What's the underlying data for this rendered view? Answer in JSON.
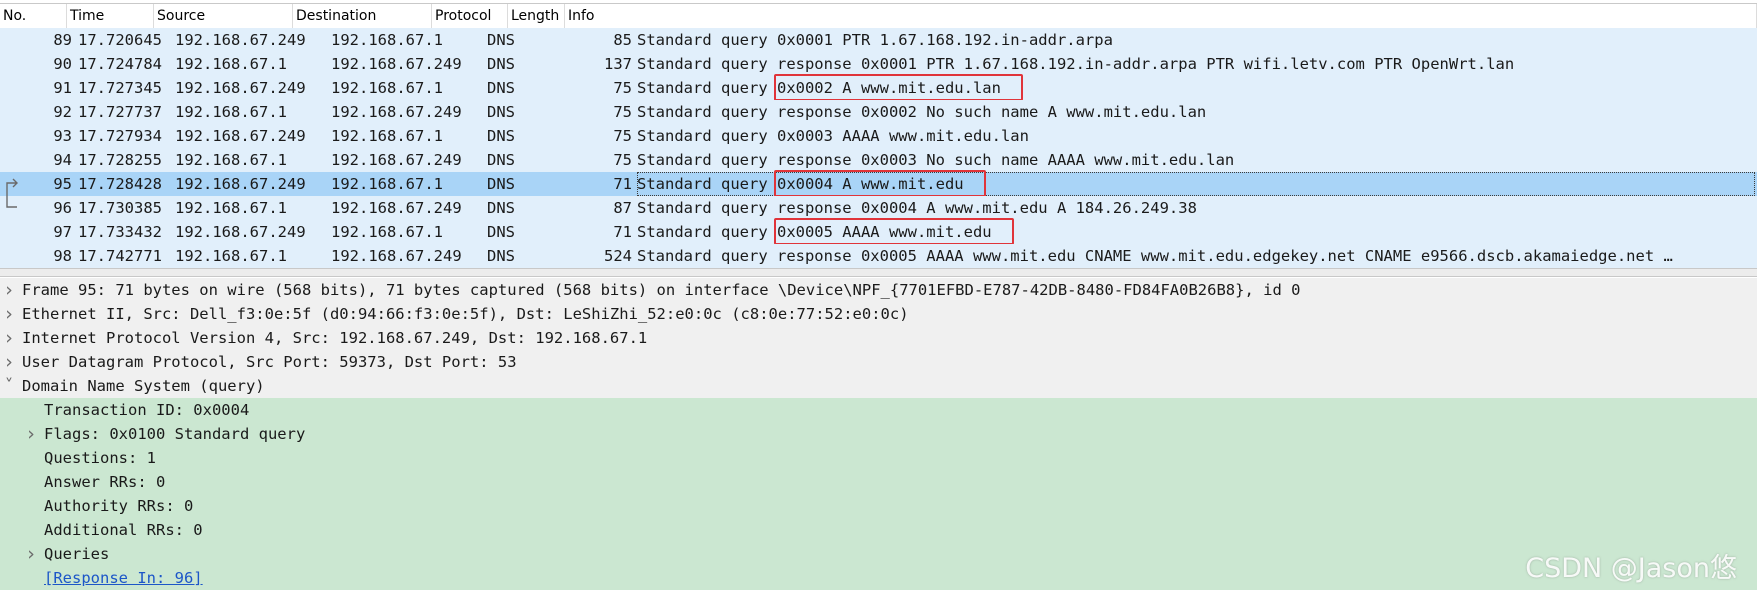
{
  "columns": [
    "No.",
    "Time",
    "Source",
    "Destination",
    "Protocol",
    "Length",
    "Info"
  ],
  "packets": [
    {
      "no": "89",
      "time": "17.720645",
      "src": "192.168.67.249",
      "dst": "192.168.67.1",
      "proto": "DNS",
      "len": "85",
      "info_prefix": "Standard query ",
      "info_rest": "0x0001 PTR 1.67.168.192.in-addr.arpa",
      "highlighted": false,
      "selected": false,
      "marker": ""
    },
    {
      "no": "90",
      "time": "17.724784",
      "src": "192.168.67.1",
      "dst": "192.168.67.249",
      "proto": "DNS",
      "len": "137",
      "info_prefix": "Standard query ",
      "info_rest": "response 0x0001 PTR 1.67.168.192.in-addr.arpa PTR wifi.letv.com PTR OpenWrt.lan",
      "highlighted": false,
      "selected": false,
      "marker": ""
    },
    {
      "no": "91",
      "time": "17.727345",
      "src": "192.168.67.249",
      "dst": "192.168.67.1",
      "proto": "DNS",
      "len": "75",
      "info_prefix": "Standard query ",
      "info_rest": "0x0002 A www.mit.edu.lan",
      "highlighted": true,
      "selected": false,
      "marker": ""
    },
    {
      "no": "92",
      "time": "17.727737",
      "src": "192.168.67.1",
      "dst": "192.168.67.249",
      "proto": "DNS",
      "len": "75",
      "info_prefix": "Standard query ",
      "info_rest": "response 0x0002 No such name A www.mit.edu.lan",
      "highlighted": false,
      "selected": false,
      "marker": ""
    },
    {
      "no": "93",
      "time": "17.727934",
      "src": "192.168.67.249",
      "dst": "192.168.67.1",
      "proto": "DNS",
      "len": "75",
      "info_prefix": "Standard query ",
      "info_rest": "0x0003 AAAA www.mit.edu.lan",
      "highlighted": false,
      "selected": false,
      "marker": ""
    },
    {
      "no": "94",
      "time": "17.728255",
      "src": "192.168.67.1",
      "dst": "192.168.67.249",
      "proto": "DNS",
      "len": "75",
      "info_prefix": "Standard query ",
      "info_rest": "response 0x0003 No such name AAAA www.mit.edu.lan",
      "highlighted": false,
      "selected": false,
      "marker": ""
    },
    {
      "no": "95",
      "time": "17.728428",
      "src": "192.168.67.249",
      "dst": "192.168.67.1",
      "proto": "DNS",
      "len": "71",
      "info_prefix": "Standard query ",
      "info_rest": "0x0004 A www.mit.edu",
      "highlighted": true,
      "selected": true,
      "marker": "request"
    },
    {
      "no": "96",
      "time": "17.730385",
      "src": "192.168.67.1",
      "dst": "192.168.67.249",
      "proto": "DNS",
      "len": "87",
      "info_prefix": "Standard query ",
      "info_rest": "response 0x0004 A www.mit.edu A 184.26.249.38",
      "highlighted": false,
      "selected": false,
      "marker": "response"
    },
    {
      "no": "97",
      "time": "17.733432",
      "src": "192.168.67.249",
      "dst": "192.168.67.1",
      "proto": "DNS",
      "len": "71",
      "info_prefix": "Standard query ",
      "info_rest": "0x0005 AAAA www.mit.edu",
      "highlighted": true,
      "selected": false,
      "marker": ""
    },
    {
      "no": "98",
      "time": "17.742771",
      "src": "192.168.67.1",
      "dst": "192.168.67.249",
      "proto": "DNS",
      "len": "524",
      "info_prefix": "Standard query ",
      "info_rest": "response 0x0005 AAAA www.mit.edu CNAME www.mit.edu.edgekey.net CNAME e9566.dscb.akamaiedge.net …",
      "highlighted": false,
      "selected": false,
      "marker": ""
    }
  ],
  "details": [
    {
      "text": "Frame 95: 71 bytes on wire (568 bits), 71 bytes captured (568 bits) on interface \\Device\\NPF_{7701EFBD-E787-42DB-8480-FD84FA0B26B8}, id 0",
      "level": 0,
      "expander": "collapsed",
      "style": "top",
      "link": false,
      "name": "detail-frame"
    },
    {
      "text": "Ethernet II, Src: Dell_f3:0e:5f (d0:94:66:f3:0e:5f), Dst: LeShiZhi_52:e0:0c (c8:0e:77:52:e0:0c)",
      "level": 0,
      "expander": "collapsed",
      "style": "top",
      "link": false,
      "name": "detail-ethernet"
    },
    {
      "text": "Internet Protocol Version 4, Src: 192.168.67.249, Dst: 192.168.67.1",
      "level": 0,
      "expander": "collapsed",
      "style": "top",
      "link": false,
      "name": "detail-ipv4"
    },
    {
      "text": "User Datagram Protocol, Src Port: 59373, Dst Port: 53",
      "level": 0,
      "expander": "collapsed",
      "style": "top",
      "link": false,
      "name": "detail-udp"
    },
    {
      "text": "Domain Name System (query)",
      "level": 0,
      "expander": "expanded",
      "style": "top",
      "link": false,
      "name": "detail-dns"
    },
    {
      "text": "Transaction ID: 0x0004",
      "level": 1,
      "expander": "none",
      "style": "green",
      "link": false,
      "name": "detail-transaction-id"
    },
    {
      "text": "Flags: 0x0100 Standard query",
      "level": 1,
      "expander": "collapsed",
      "style": "green",
      "link": false,
      "name": "detail-flags"
    },
    {
      "text": "Questions: 1",
      "level": 1,
      "expander": "none",
      "style": "green",
      "link": false,
      "name": "detail-questions"
    },
    {
      "text": "Answer RRs: 0",
      "level": 1,
      "expander": "none",
      "style": "green",
      "link": false,
      "name": "detail-answer-rrs"
    },
    {
      "text": "Authority RRs: 0",
      "level": 1,
      "expander": "none",
      "style": "green",
      "link": false,
      "name": "detail-authority-rrs"
    },
    {
      "text": "Additional RRs: 0",
      "level": 1,
      "expander": "none",
      "style": "green",
      "link": false,
      "name": "detail-additional-rrs"
    },
    {
      "text": "Queries",
      "level": 1,
      "expander": "collapsed",
      "style": "green",
      "link": false,
      "name": "detail-queries"
    },
    {
      "text": "[Response In: 96]",
      "level": 1,
      "expander": "none",
      "style": "green",
      "link": true,
      "name": "detail-response-in-link"
    }
  ],
  "icons": {
    "collapsed": "chevron-right-icon",
    "expanded": "chevron-down-icon"
  },
  "colors": {
    "row_bg": "#e1effb",
    "selected_bg": "#a9d4f7",
    "highlight_box": "#e0343a",
    "detail_green": "#cbe7d1",
    "link": "#1c56c8"
  },
  "watermark": "CSDN @Jason悠"
}
